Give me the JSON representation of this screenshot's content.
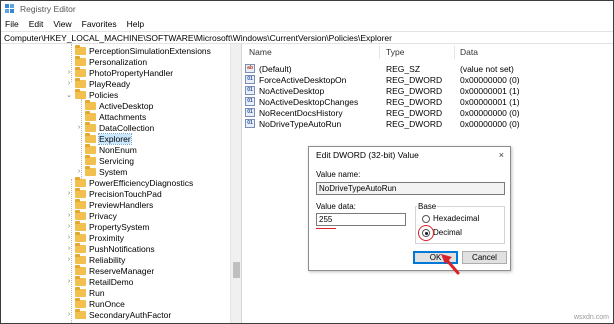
{
  "window": {
    "title": "Registry Editor"
  },
  "menu": [
    "File",
    "Edit",
    "View",
    "Favorites",
    "Help"
  ],
  "address": "Computer\\HKEY_LOCAL_MACHINE\\SOFTWARE\\Microsoft\\Windows\\CurrentVersion\\Policies\\Explorer",
  "tree": [
    {
      "label": "PerceptionSimulationExtensions",
      "level": 0,
      "expander": "none"
    },
    {
      "label": "Personalization",
      "level": 0,
      "expander": "none"
    },
    {
      "label": "PhotoPropertyHandler",
      "level": 0,
      "expander": "collapsed"
    },
    {
      "label": "PlayReady",
      "level": 0,
      "expander": "collapsed"
    },
    {
      "label": "Policies",
      "level": 0,
      "expander": "expanded"
    },
    {
      "label": "ActiveDesktop",
      "level": 1,
      "expander": "none"
    },
    {
      "label": "Attachments",
      "level": 1,
      "expander": "none"
    },
    {
      "label": "DataCollection",
      "level": 1,
      "expander": "collapsed"
    },
    {
      "label": "Explorer",
      "level": 1,
      "expander": "none",
      "selected": true
    },
    {
      "label": "NonEnum",
      "level": 1,
      "expander": "none"
    },
    {
      "label": "Servicing",
      "level": 1,
      "expander": "none"
    },
    {
      "label": "System",
      "level": 1,
      "expander": "collapsed"
    },
    {
      "label": "PowerEfficiencyDiagnostics",
      "level": 0,
      "expander": "none"
    },
    {
      "label": "PrecisionTouchPad",
      "level": 0,
      "expander": "collapsed"
    },
    {
      "label": "PreviewHandlers",
      "level": 0,
      "expander": "none"
    },
    {
      "label": "Privacy",
      "level": 0,
      "expander": "collapsed"
    },
    {
      "label": "PropertySystem",
      "level": 0,
      "expander": "collapsed"
    },
    {
      "label": "Proximity",
      "level": 0,
      "expander": "collapsed"
    },
    {
      "label": "PushNotifications",
      "level": 0,
      "expander": "collapsed"
    },
    {
      "label": "Reliability",
      "level": 0,
      "expander": "collapsed"
    },
    {
      "label": "ReserveManager",
      "level": 0,
      "expander": "none"
    },
    {
      "label": "RetailDemo",
      "level": 0,
      "expander": "collapsed"
    },
    {
      "label": "Run",
      "level": 0,
      "expander": "none"
    },
    {
      "label": "RunOnce",
      "level": 0,
      "expander": "none"
    },
    {
      "label": "SecondaryAuthFactor",
      "level": 0,
      "expander": "collapsed"
    }
  ],
  "columns": {
    "name": "Name",
    "type": "Type",
    "data": "Data"
  },
  "values": [
    {
      "name": "(Default)",
      "type": "REG_SZ",
      "data": "(value not set)",
      "icon": "string"
    },
    {
      "name": "ForceActiveDesktopOn",
      "type": "REG_DWORD",
      "data": "0x00000000 (0)",
      "icon": "binary"
    },
    {
      "name": "NoActiveDesktop",
      "type": "REG_DWORD",
      "data": "0x00000001 (1)",
      "icon": "binary"
    },
    {
      "name": "NoActiveDesktopChanges",
      "type": "REG_DWORD",
      "data": "0x00000001 (1)",
      "icon": "binary"
    },
    {
      "name": "NoRecentDocsHistory",
      "type": "REG_DWORD",
      "data": "0x00000000 (0)",
      "icon": "binary"
    },
    {
      "name": "NoDriveTypeAutoRun",
      "type": "REG_DWORD",
      "data": "0x00000000 (0)",
      "icon": "binary"
    }
  ],
  "dialog": {
    "title": "Edit DWORD (32-bit) Value",
    "close": "×",
    "value_name_label": "Value name:",
    "value_name": "NoDriveTypeAutoRun",
    "value_data_label": "Value data:",
    "value_data": "255",
    "base_label": "Base",
    "hex_label": "Hexadecimal",
    "dec_label": "Decimal",
    "base_selected": "decimal",
    "ok": "OK",
    "cancel": "Cancel"
  },
  "watermark": "wsxdn.com",
  "colors": {
    "annotation": "#d9232b",
    "folder": "#f1c04e",
    "selection": "#cce8ff"
  }
}
